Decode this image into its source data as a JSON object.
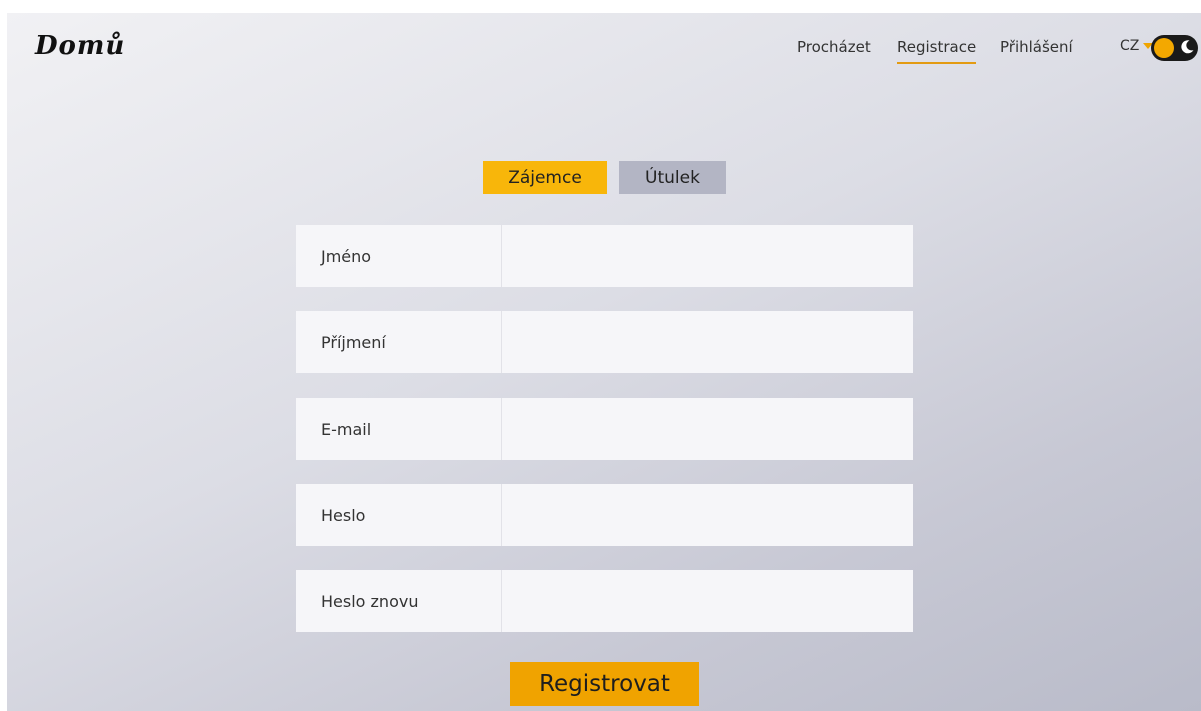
{
  "brand": {
    "logo_text": "Domů"
  },
  "nav": {
    "browse": "Procházet",
    "register": "Registrace",
    "login": "Přihlášení",
    "language": "CZ"
  },
  "theme_toggle": {
    "state": "light",
    "icon": "moon-icon"
  },
  "account_type_tabs": {
    "selected": "Zájemce",
    "items": [
      "Zájemce",
      "Útulek"
    ]
  },
  "form": {
    "fields": [
      {
        "label": "Jméno",
        "value": ""
      },
      {
        "label": "Příjmení",
        "value": ""
      },
      {
        "label": "E-mail",
        "value": ""
      },
      {
        "label": "Heslo",
        "value": ""
      },
      {
        "label": "Heslo znovu",
        "value": ""
      }
    ],
    "submit_label": "Registrovat"
  },
  "colors": {
    "accent": "#f0a300",
    "tab_active": "#f8b60a",
    "tab_inactive": "#b3b5c4"
  }
}
